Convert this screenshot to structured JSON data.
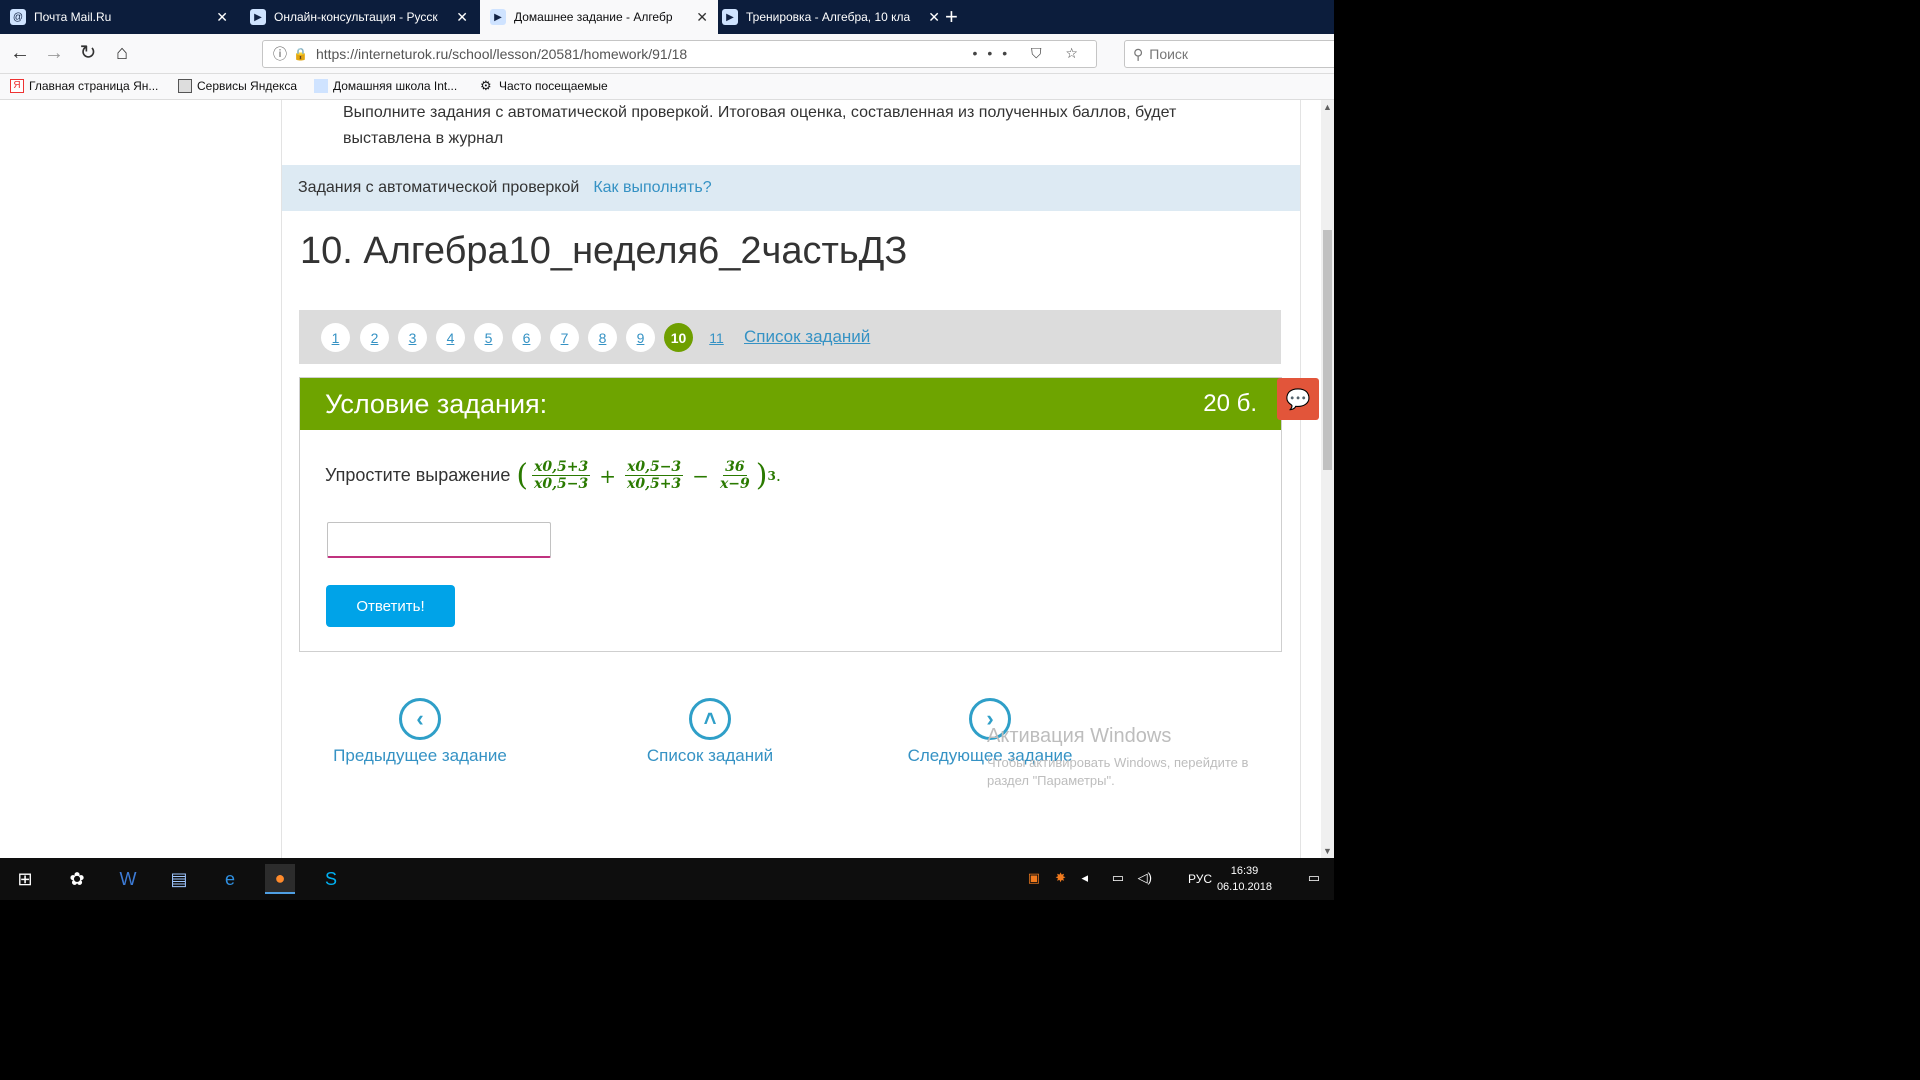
{
  "tabs": [
    {
      "title": "Почта Mail.Ru",
      "active": false
    },
    {
      "title": "Онлайн-консультация - Русск",
      "active": false
    },
    {
      "title": "Домашнее задание - Алгебр",
      "active": true
    },
    {
      "title": "Тренировка - Алгебра, 10 кла",
      "active": false
    }
  ],
  "address": {
    "url": "https://interneturok.ru/school/lesson/20581/homework/91/18"
  },
  "search": {
    "placeholder": "Поиск"
  },
  "bookmarks": [
    "Главная страница Ян...",
    "Сервисы Яндекса",
    "Домашняя школа Int...",
    "Часто посещаемые"
  ],
  "page": {
    "intro": "Выполните задания с автоматической проверкой. Итоговая оценка, составленная из полученных баллов, будет выставлена в журнал",
    "auto_check_label": "Задания с автоматической проверкой",
    "how_to_link": "Как выполнять?",
    "homework_title": "10. Алгебра10_неделя6_2частьДЗ",
    "task_numbers": [
      "1",
      "2",
      "3",
      "4",
      "5",
      "6",
      "7",
      "8",
      "9",
      "10",
      "11"
    ],
    "current_task": "10",
    "task_list_link": "Список заданий",
    "condition_title": "Условие задания:",
    "points": "20 б.",
    "question_text": "Упростите выражение",
    "formula": {
      "f1_num": "x0,5+3",
      "f1_den": "x0,5−3",
      "f2_num": "x0,5−3",
      "f2_den": "x0,5+3",
      "f3_num": "36",
      "f3_den": "x−9",
      "power": "3"
    },
    "answer_value": "",
    "answer_button": "Ответить!",
    "prev_task": "Предыдущее задание",
    "list_tasks": "Список заданий",
    "next_task": "Следующее задание"
  },
  "watermark": {
    "title": "Активация Windows",
    "text": "Чтобы активировать Windows, перейдите в раздел \"Параметры\"."
  },
  "taskbar": {
    "lang": "РУС",
    "time": "16:39",
    "date": "06.10.2018"
  },
  "colors": {
    "green_header": "#6ea400",
    "link_blue": "#3592c4",
    "button_blue": "#00a3e8",
    "chat_orange": "#e2553a"
  }
}
